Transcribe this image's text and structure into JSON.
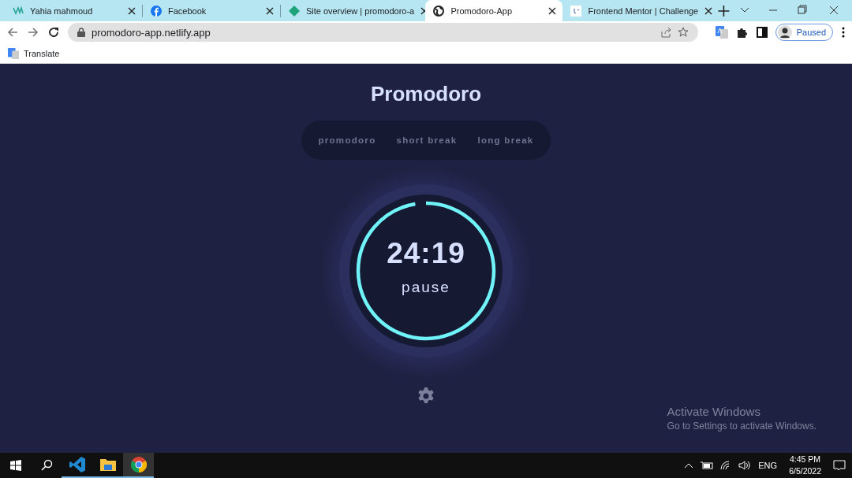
{
  "browser": {
    "tabs": [
      {
        "kind": "ym",
        "title": "Yahia mahmoud",
        "selected": false
      },
      {
        "kind": "facebook",
        "title": "Facebook",
        "selected": false
      },
      {
        "kind": "diamond",
        "title": "Site overview | promodoro-a",
        "selected": false
      },
      {
        "kind": "globe",
        "title": "Promodoro-App",
        "selected": true
      },
      {
        "kind": "fm",
        "title": "Frontend Mentor | Challenge",
        "selected": false
      }
    ],
    "address": "promodoro-app.netlify.app",
    "profile": "Paused",
    "bookmarks": [
      "Translate"
    ]
  },
  "app": {
    "title": "Promodoro",
    "modes": [
      {
        "label": "promodoro",
        "selected": false
      },
      {
        "label": "short break",
        "selected": false
      },
      {
        "label": "long break",
        "selected": false
      }
    ],
    "timer": {
      "time": "24:19",
      "action": "pause",
      "level": 0.973
    }
  },
  "overlay": {
    "title": "Activate Windows",
    "subtitle": "Go to Settings to activate Windows."
  },
  "taskbar": {
    "language": "ENG",
    "time": "4:45 PM",
    "date": "6/5/2022"
  }
}
